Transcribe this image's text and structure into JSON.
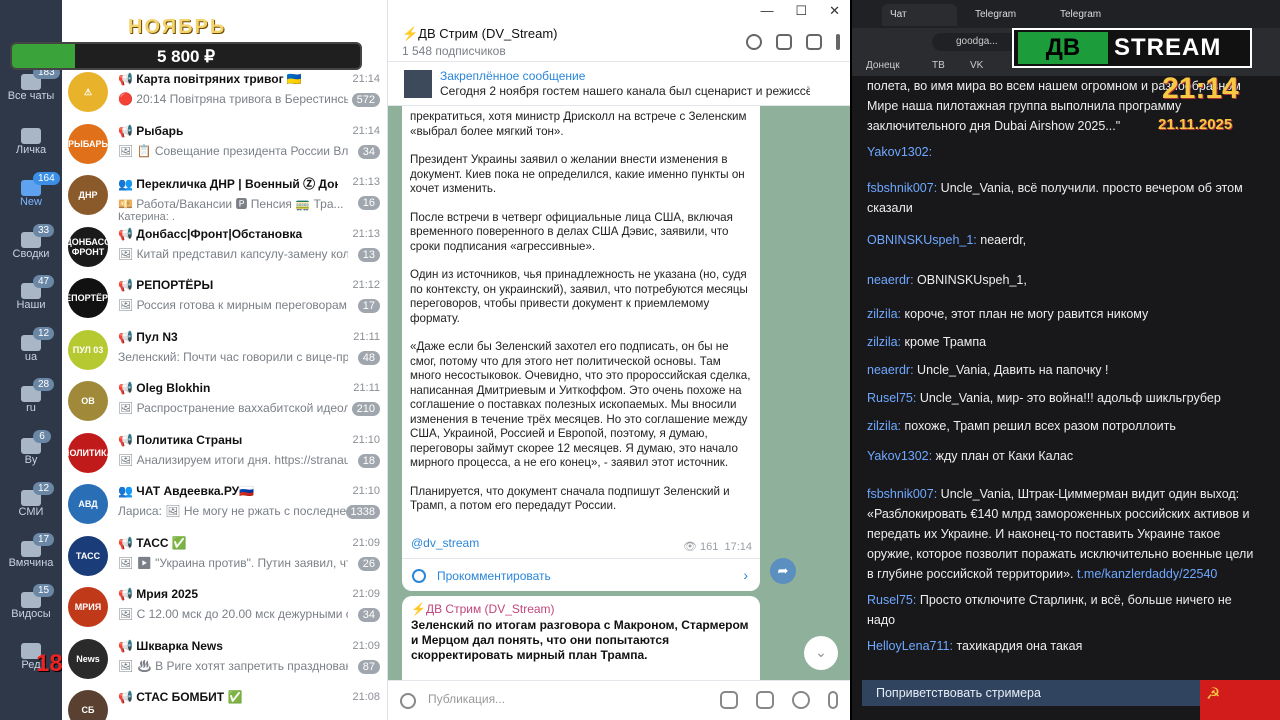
{
  "nav": {
    "items": [
      {
        "label": "Все чаты",
        "badge": "183"
      },
      {
        "label": "Личка",
        "badge": ""
      },
      {
        "label": "New",
        "badge": "164"
      },
      {
        "label": "Сводки",
        "badge": "33"
      },
      {
        "label": "Наши",
        "badge": "47"
      },
      {
        "label": "ua",
        "badge": "12"
      },
      {
        "label": "ru",
        "badge": "28"
      },
      {
        "label": "By",
        "badge": "6"
      },
      {
        "label": "СМИ",
        "badge": "12"
      },
      {
        "label": "Вмячина",
        "badge": "17"
      },
      {
        "label": "Видосы",
        "badge": "15"
      },
      {
        "label": "Ред",
        "badge": ""
      }
    ]
  },
  "month_overlay": {
    "title": "НОЯБРЬ",
    "amount": "5 800 ₽",
    "progress": 0.18
  },
  "age_overlay": "18+",
  "chats": [
    {
      "title": "📢 Карта повітряних тривог 🇺🇦",
      "time": "21:14",
      "preview": "🔴 20:14 Повітряна тривога в Берестинськ...",
      "badge": "572",
      "avatar_color": "#e8b22a",
      "avatar_text": "⚠"
    },
    {
      "title": "📢 Рыбарь",
      "time": "21:14",
      "preview": "🖼 📋 Совещание президента России Влади...",
      "badge": "34",
      "avatar_color": "#e0701a",
      "avatar_text": "РЫБАРЬ"
    },
    {
      "title": "👥 Перекличка ДНР | Военный Ⓩ Донецк",
      "time": "21:13",
      "preview": "💴 Работа/Вакансии  🅿 Пенсия  🚃 Тра...",
      "preview2": "Катерина: .",
      "badge": "16",
      "avatar_color": "#8a5a2a",
      "avatar_text": "ДНР"
    },
    {
      "title": "📢 Донбасс|Фронт|Обстановка",
      "time": "21:13",
      "preview": "🖼 Китай представил капсулу-замену колон...",
      "badge": "13",
      "avatar_color": "#1a1a1a",
      "avatar_text": "ДОНБАСС ФРОНТ"
    },
    {
      "title": "📢 РЕПОРТЁРЫ",
      "time": "21:12",
      "preview": "🖼 Россия готова к мирным переговорам, н...",
      "badge": "17",
      "avatar_color": "#111111",
      "avatar_text": "РЕПОРТЁРЫ"
    },
    {
      "title": "📢 Пул N3",
      "time": "21:11",
      "preview": "Зеленский:   Почти час говорили с вице-пре...",
      "badge": "48",
      "avatar_color": "#b6c930",
      "avatar_text": "ПУЛ 03"
    },
    {
      "title": "📢 Oleg Blokhin",
      "time": "21:11",
      "preview": "🖼 Распространение ваххабитской идеоло...",
      "badge": "210",
      "avatar_color": "#a08a3a",
      "avatar_text": "OB"
    },
    {
      "title": "📢 Политика Страны",
      "time": "21:10",
      "preview": "🖼 Анализируем итоги дня.  https://stranaua...",
      "badge": "18",
      "avatar_color": "#c01a1a",
      "avatar_text": "ПОЛИТИКА"
    },
    {
      "title": "👥 ЧАТ Авдеевка.РУ🇷🇺",
      "time": "21:10",
      "preview": "Лариса: 🖼 Не могу не ржать с последнег...",
      "badge": "1338",
      "avatar_color": "#2a6fb6",
      "avatar_text": "АВД"
    },
    {
      "title": "📢 ТАСС ✅",
      "time": "21:09",
      "preview": "🖼 ▶ \"Украина против\". Путин заявил, что ...",
      "badge": "26",
      "avatar_color": "#1a3d7a",
      "avatar_text": "ТАСС"
    },
    {
      "title": "📢 Мрия 2025",
      "time": "21:09",
      "preview": "🖼 С 12.00 мск до 20.00 мск дежурными сред...",
      "badge": "34",
      "avatar_color": "#c03a1a",
      "avatar_text": "МРИЯ"
    },
    {
      "title": "📢 Шкварка News",
      "time": "21:09",
      "preview": "🖼 ♨ В Риге хотят запретить празднование...",
      "badge": "87",
      "avatar_color": "#2a2a2a",
      "avatar_text": "News"
    },
    {
      "title": "📢 СТАС БОМБИТ ✅",
      "time": "21:08",
      "preview": "",
      "badge": "",
      "avatar_color": "#5a4030",
      "avatar_text": "СБ"
    }
  ],
  "channel": {
    "title": "⚡ДВ Стрим (DV_Stream)",
    "subscribers": "1 548 подписчиков",
    "pinned_label": "Закреплённое сообщение",
    "pinned_text": "Сегодня 2 ноября гостем нашего канала был сценарист и режиссёр...",
    "post_paragraphs": [
      "прекратиться, хотя министр Дрисколл на встрече с Зеленским «выбрал более мягкий тон».",
      "Президент Украины заявил о желании внести изменения в документ. Киев пока не определился, какие именно пункты он хочет изменить.",
      "После встречи в четверг официальные лица США, включая временного поверенного в делах США Дэвис, заявили, что сроки подписания «агрессивные».",
      "Один из источников, чья принадлежность не указана (но, судя по контексту, он украинский), заявил, что потребуются месяцы переговоров, чтобы привести документ к приемлемому формату.",
      "«Даже если бы Зеленский захотел его подписать, он бы не смог, потому что для этого нет политической основы. Там много несостыковок. Очевидно, что это пророссийская сделка, написанная Дмитриевым и Уиткоффом. Это очень похоже на соглашение о поставках полезных ископаемых. Мы вносили изменения в течение трёх месяцев. Но это соглашение между США, Украиной, Россией и Европой, поэтому, я думаю, переговоры займут скорее 12 месяцев. Я думаю, это начало мирного процесса, а не его конец», - заявил этот источник.",
      "Планируется, что документ сначала подпишут Зеленский и Трамп, а потом его передадут России."
    ],
    "post_tag": "@dv_stream",
    "views": "👁 161",
    "post_time": "17:14",
    "comment_label": "Прокомментировать",
    "post2_author": "⚡ДВ Стрим (DV_Stream)",
    "post2_text": "Зеленский по итогам разговора с Макроном, Стармером и Мерцом дал понять, что они попытаются скорректировать мирный план Трампа.",
    "compose_placeholder": "Публикация..."
  },
  "browser": {
    "tabs": [
      "Чат",
      "Telegram",
      "Telegram"
    ],
    "url": "goodga...",
    "bookmarks": [
      "Донецк",
      "ТВ",
      "VK"
    ],
    "logo_left": "ДВ",
    "logo_right": "STREAM",
    "clock": "21:14",
    "date": "21.11.2025"
  },
  "stream_chat": {
    "messages": [
      {
        "user": "",
        "text": "полета, во имя мира во всем нашем огромном и разнообразном Мире наша пилотажная группа выполнила программу заключительного дня Dubai Airshow 2025...\""
      },
      {
        "user": "Yakov1302:",
        "text": ""
      },
      {
        "user": "fsbshnik007:",
        "text": "Uncle_Vania, всё получили. просто вечером об этом сказали"
      },
      {
        "user": "OBNINSKUspeh_1:",
        "text": "neaerdr,"
      },
      {
        "user": "neaerdr:",
        "text": "OBNINSKUspeh_1,"
      },
      {
        "user": "zilzila:",
        "text": "короче, этот план не могу равится никому"
      },
      {
        "user": "zilzila:",
        "text": "кроме Трампа"
      },
      {
        "user": "neaerdr:",
        "text": "Uncle_Vania, Давить на папочку !"
      },
      {
        "user": "Rusel75:",
        "text": "Uncle_Vania, мир- это война!!! адольф шикльгрубер"
      },
      {
        "user": "zilzila:",
        "text": "похоже, Трамп решил всех разом потроллоить"
      },
      {
        "user": "Yakov1302:",
        "text": "жду план от Каки Калас"
      },
      {
        "user": "fsbshnik007:",
        "text": "Uncle_Vania, Штрак-Циммерман видит один выход: «Разблокировать €140 млрд замороженных российских активов и передать их Украине. И наконец-то поставить Украине такое оружие, которое позволит поражать исключительно военные цели в глубине российской территории».",
        "link": "t.me/kanzlerdaddy/22540"
      },
      {
        "user": "Rusel75:",
        "text": "Просто отключите Старлинк, и всё, больше ничего не надо"
      },
      {
        "user": "HelloyLena711:",
        "text": "тахикардия она такая"
      }
    ],
    "greet_button": "Поприветствовать стримера"
  },
  "colors": {
    "accent": "#2a86d9",
    "nav_bg": "#2e3848",
    "chat_bg": "#8fb09a",
    "stream_bg": "#18181b"
  }
}
